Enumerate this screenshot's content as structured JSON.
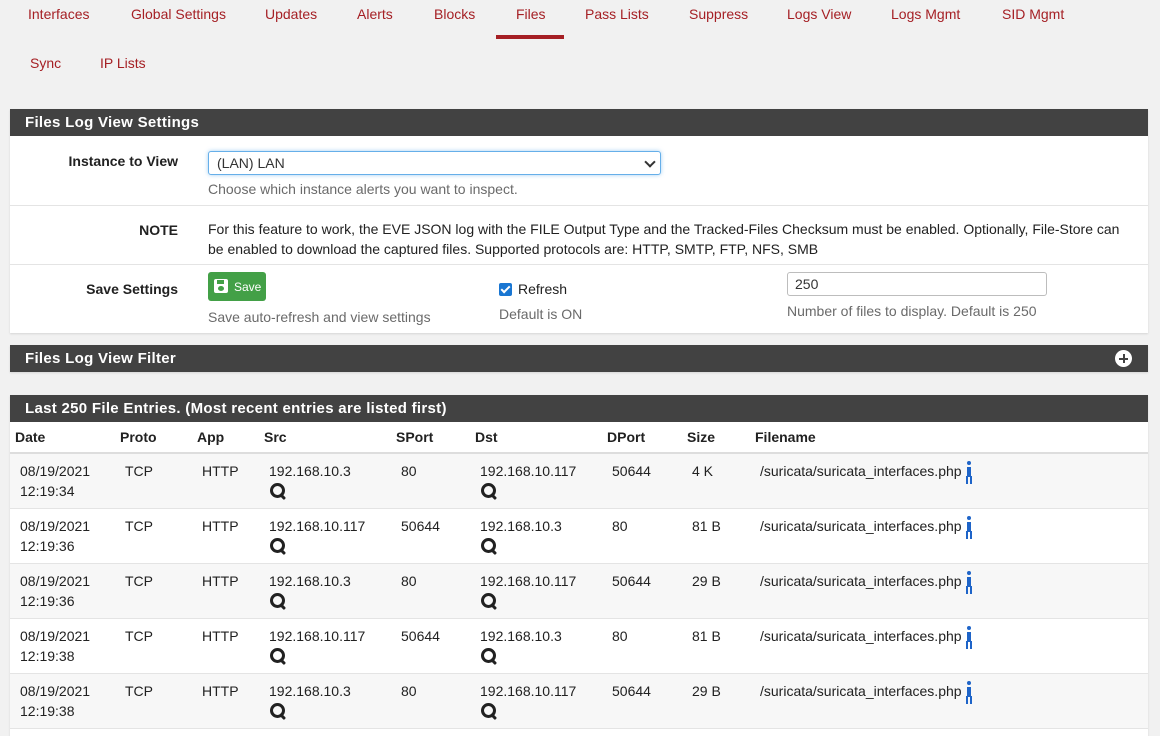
{
  "tabs": [
    {
      "label": "Interfaces"
    },
    {
      "label": "Global Settings"
    },
    {
      "label": "Updates"
    },
    {
      "label": "Alerts"
    },
    {
      "label": "Blocks"
    },
    {
      "label": "Files",
      "active": true
    },
    {
      "label": "Pass Lists"
    },
    {
      "label": "Suppress"
    },
    {
      "label": "Logs View"
    },
    {
      "label": "Logs Mgmt"
    },
    {
      "label": "SID Mgmt"
    },
    {
      "label": "Sync"
    },
    {
      "label": "IP Lists"
    }
  ],
  "settings": {
    "title": "Files Log View Settings",
    "instance_label": "Instance to View",
    "instance_value": "(LAN) LAN",
    "instance_help": "Choose which instance alerts you want to inspect.",
    "note_label": "NOTE",
    "note_text": "For this feature to work, the EVE JSON log with the FILE Output Type and the Tracked-Files Checksum must be enabled. Optionally, File-Store can be enabled to download the captured files. Supported protocols are: HTTP, SMTP, FTP, NFS, SMB",
    "save_label": "Save Settings",
    "save_button": "Save",
    "save_help": "Save auto-refresh and view settings",
    "refresh_label": "Refresh",
    "refresh_checked": true,
    "refresh_help": "Default is ON",
    "count_value": "250",
    "count_help": "Number of files to display. Default is 250"
  },
  "filter": {
    "title": "Files Log View Filter"
  },
  "entries": {
    "title": "Last 250 File Entries. (Most recent entries are listed first)",
    "columns": [
      "Date",
      "Proto",
      "App",
      "Src",
      "SPort",
      "Dst",
      "DPort",
      "Size",
      "Filename"
    ],
    "rows": [
      {
        "date": "08/19/2021",
        "time": "12:19:34",
        "proto": "TCP",
        "app": "HTTP",
        "src": "192.168.10.3",
        "sport": "80",
        "dst": "192.168.10.117",
        "dport": "50644",
        "size": "4 K",
        "filename": "/suricata/suricata_interfaces.php"
      },
      {
        "date": "08/19/2021",
        "time": "12:19:36",
        "proto": "TCP",
        "app": "HTTP",
        "src": "192.168.10.117",
        "sport": "50644",
        "dst": "192.168.10.3",
        "dport": "80",
        "size": "81 B",
        "filename": "/suricata/suricata_interfaces.php"
      },
      {
        "date": "08/19/2021",
        "time": "12:19:36",
        "proto": "TCP",
        "app": "HTTP",
        "src": "192.168.10.3",
        "sport": "80",
        "dst": "192.168.10.117",
        "dport": "50644",
        "size": "29 B",
        "filename": "/suricata/suricata_interfaces.php"
      },
      {
        "date": "08/19/2021",
        "time": "12:19:38",
        "proto": "TCP",
        "app": "HTTP",
        "src": "192.168.10.117",
        "sport": "50644",
        "dst": "192.168.10.3",
        "dport": "80",
        "size": "81 B",
        "filename": "/suricata/suricata_interfaces.php"
      },
      {
        "date": "08/19/2021",
        "time": "12:19:38",
        "proto": "TCP",
        "app": "HTTP",
        "src": "192.168.10.3",
        "sport": "80",
        "dst": "192.168.10.117",
        "dport": "50644",
        "size": "29 B",
        "filename": "/suricata/suricata_interfaces.php"
      }
    ]
  },
  "colors": {
    "accent": "#a51f24",
    "panel_header": "#424242",
    "save_green": "#43a047",
    "info_blue": "#1e64c8"
  }
}
